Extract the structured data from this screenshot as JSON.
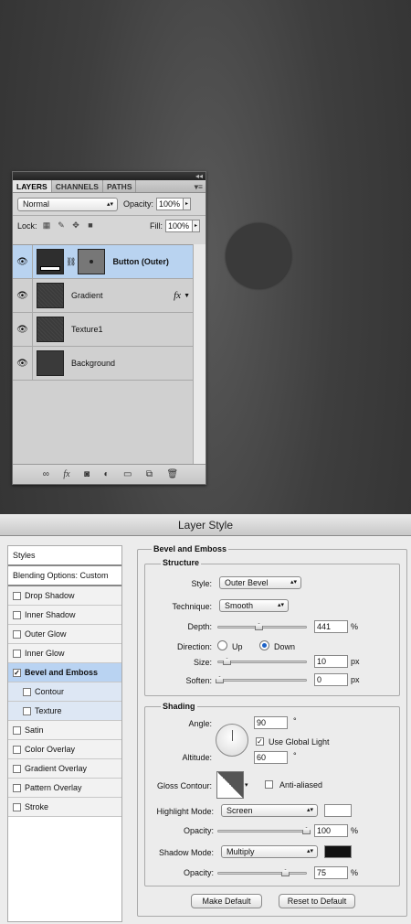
{
  "layers_panel": {
    "collapse_icon": "double-chevron-left",
    "tabs": [
      "LAYERS",
      "CHANNELS",
      "PATHS"
    ],
    "active_tab": "LAYERS",
    "blend_mode": "Normal",
    "opacity_label": "Opacity:",
    "opacity_value": "100%",
    "lock_label": "Lock:",
    "fill_label": "Fill:",
    "fill_value": "100%",
    "layers": [
      {
        "name": "Button (Outer)",
        "selected": true,
        "has_mask": true,
        "linked": true
      },
      {
        "name": "Gradient",
        "selected": false,
        "fx": "fx"
      },
      {
        "name": "Texture1",
        "selected": false
      },
      {
        "name": "Background",
        "selected": false
      }
    ],
    "bottom_icons": [
      "link-icon",
      "fx-icon",
      "mask-icon",
      "adjustment-icon",
      "folder-icon",
      "new-layer-icon",
      "trash-icon"
    ]
  },
  "dialog": {
    "title": "Layer Style",
    "styles_list": {
      "header": "Styles",
      "blending": "Blending Options: Custom",
      "items": [
        {
          "label": "Drop Shadow",
          "checked": false
        },
        {
          "label": "Inner Shadow",
          "checked": false
        },
        {
          "label": "Outer Glow",
          "checked": false
        },
        {
          "label": "Inner Glow",
          "checked": false
        },
        {
          "label": "Bevel and Emboss",
          "checked": true
        },
        {
          "label": "Contour",
          "checked": false
        },
        {
          "label": "Texture",
          "checked": false
        },
        {
          "label": "Satin",
          "checked": false
        },
        {
          "label": "Color Overlay",
          "checked": false
        },
        {
          "label": "Gradient Overlay",
          "checked": false
        },
        {
          "label": "Pattern Overlay",
          "checked": false
        },
        {
          "label": "Stroke",
          "checked": false
        }
      ]
    },
    "section_title": "Bevel and Emboss",
    "structure": {
      "title": "Structure",
      "style_label": "Style:",
      "style_value": "Outer Bevel",
      "technique_label": "Technique:",
      "technique_value": "Smooth",
      "depth_label": "Depth:",
      "depth_value": "441",
      "depth_unit": "%",
      "direction_label": "Direction:",
      "dir_up": "Up",
      "dir_down": "Down",
      "direction_selected": "Down",
      "size_label": "Size:",
      "size_value": "10",
      "size_unit": "px",
      "soften_label": "Soften:",
      "soften_value": "0",
      "soften_unit": "px"
    },
    "shading": {
      "title": "Shading",
      "angle_label": "Angle:",
      "angle_value": "90",
      "degree": "°",
      "global_light_label": "Use Global Light",
      "global_light_checked": true,
      "altitude_label": "Altitude:",
      "altitude_value": "60",
      "gloss_label": "Gloss Contour:",
      "anti_aliased_label": "Anti-aliased",
      "anti_aliased_checked": false,
      "highlight_mode_label": "Highlight Mode:",
      "highlight_mode_value": "Screen",
      "highlight_color": "#ffffff",
      "opacity_label": "Opacity:",
      "highlight_opacity": "100",
      "percent": "%",
      "shadow_mode_label": "Shadow Mode:",
      "shadow_mode_value": "Multiply",
      "shadow_color": "#111111",
      "shadow_opacity": "75"
    },
    "make_default": "Make Default",
    "reset_default": "Reset to Default"
  }
}
